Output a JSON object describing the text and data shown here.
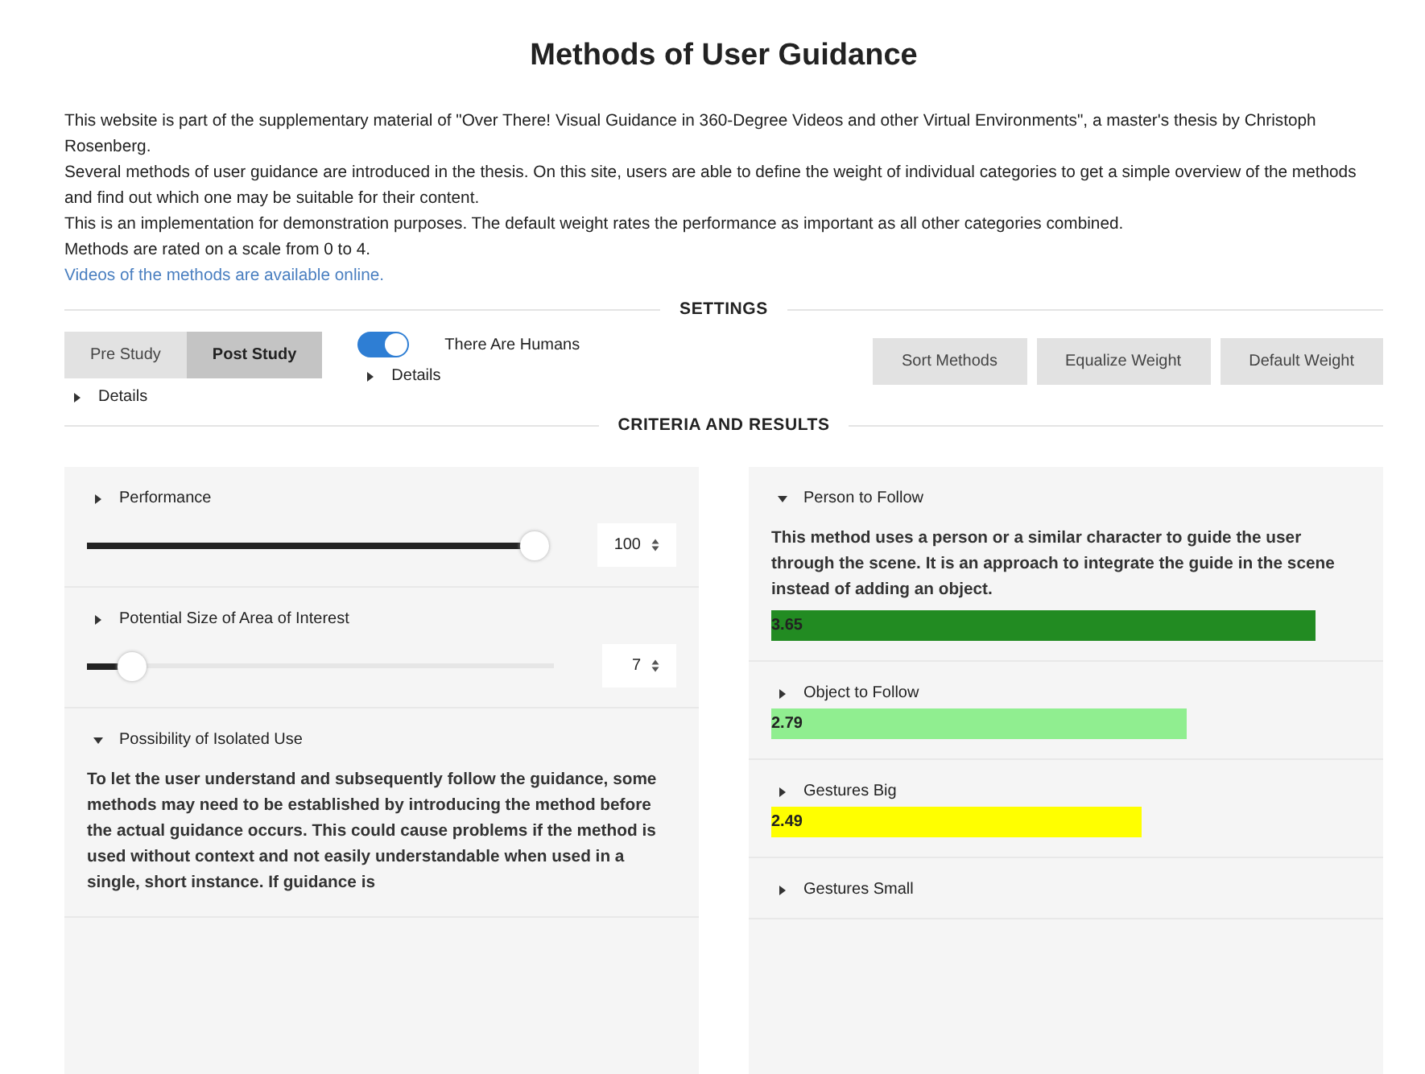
{
  "page": {
    "title": "Methods of User Guidance"
  },
  "intro": {
    "paragraphs": [
      "This website is part of the supplementary material of \"Over There! Visual Guidance in 360-Degree Videos and other Virtual Environments\", a master's thesis by Christoph Rosenberg.",
      "Several methods of user guidance are introduced in the thesis. On this site, users are able to define the weight of individual categories to get a simple overview of the methods and find out which one may be suitable for their content.",
      "This is an implementation for demonstration purposes. The default weight rates the performance as important as all other categories combined.",
      "Methods are rated on a scale from 0 to 4."
    ],
    "link": "Videos of the methods are available online."
  },
  "settings": {
    "heading": "SETTINGS",
    "study_tabs": [
      {
        "label": "Pre Study",
        "selected": false
      },
      {
        "label": "Post Study",
        "selected": true
      }
    ],
    "study_details": {
      "label": "Details",
      "expanded": false
    },
    "humans_toggle": {
      "label": "There Are Humans",
      "on": true
    },
    "humans_details": {
      "label": "Details",
      "expanded": false
    },
    "buttons": [
      "Sort Methods",
      "Equalize Weight",
      "Default Weight"
    ]
  },
  "criteria_heading": "CRITERIA AND RESULTS",
  "criteria": [
    {
      "title": "Performance",
      "expanded": false,
      "level": 1.0,
      "value": "100"
    },
    {
      "title": "Potential Size of Area of Interest",
      "expanded": false,
      "level": 0.07,
      "value": "7"
    },
    {
      "title": "Possibility of Isolated Use",
      "expanded": true,
      "description": "To let the user understand and subsequently follow the guidance, some methods may need to be established by introducing the method before the actual guidance occurs. This could cause problems if the method is used without context and not easily understandable when used in a single, short instance. If guidance is"
    }
  ],
  "results": [
    {
      "name": "Person to Follow",
      "expanded": true,
      "description": "This method uses a person or a similar character to guide the user through the scene. It is an approach to integrate the guide in the scene instead of adding an object.",
      "score": "3.65",
      "color": "#228b22"
    },
    {
      "name": "Object to Follow",
      "expanded": false,
      "score": "2.79",
      "color": "#90ee90"
    },
    {
      "name": "Gestures Big",
      "expanded": false,
      "score": "2.49",
      "color": "#ffff00"
    },
    {
      "name": "Gestures Small",
      "expanded": false
    }
  ]
}
